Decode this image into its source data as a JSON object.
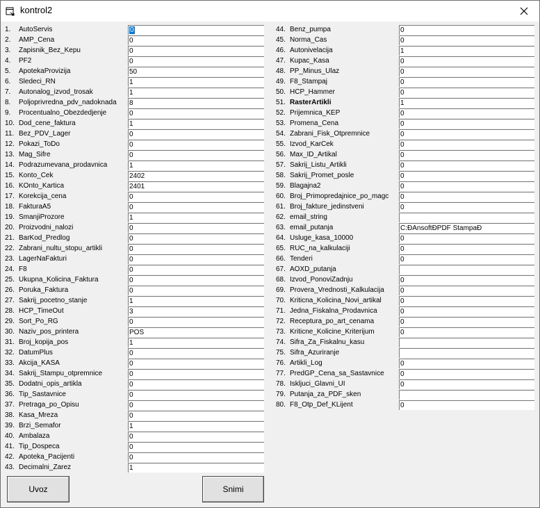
{
  "window": {
    "title": "kontrol2"
  },
  "left_rows": [
    {
      "num": "1.",
      "name": "AutoServis",
      "value": "0"
    },
    {
      "num": "2.",
      "name": "AMP_Cena",
      "value": "0"
    },
    {
      "num": "3.",
      "name": "Zapisnik_Bez_Kepu",
      "value": "0"
    },
    {
      "num": "4.",
      "name": "PF2",
      "value": "0"
    },
    {
      "num": "5.",
      "name": "ApotekaProvizija",
      "value": "50"
    },
    {
      "num": "6.",
      "name": "Sledeci_RN",
      "value": "1"
    },
    {
      "num": "7.",
      "name": "Autonalog_izvod_trosak",
      "value": "1"
    },
    {
      "num": "8.",
      "name": "Poljoprivredna_pdv_nadoknada",
      "value": "8"
    },
    {
      "num": "9.",
      "name": "Procentualno_Obezdedjenje",
      "value": "0"
    },
    {
      "num": "10.",
      "name": "Dod_cene_faktura",
      "value": "1"
    },
    {
      "num": "11.",
      "name": "Bez_PDV_Lager",
      "value": "0"
    },
    {
      "num": "12.",
      "name": "Pokazi_ToDo",
      "value": "0"
    },
    {
      "num": "13.",
      "name": "Mag_Sifre",
      "value": "0"
    },
    {
      "num": "14.",
      "name": "Podrazumevana_prodavnica",
      "value": "1"
    },
    {
      "num": "15.",
      "name": "Konto_Cek",
      "value": "2402"
    },
    {
      "num": "16.",
      "name": "KOnto_Kartica",
      "value": "2401"
    },
    {
      "num": "17.",
      "name": "Korekcija_cena",
      "value": "0"
    },
    {
      "num": "18.",
      "name": "FakturaA5",
      "value": "0"
    },
    {
      "num": "19.",
      "name": "SmanjiProzore",
      "value": "1"
    },
    {
      "num": "20.",
      "name": "Proizvodni_nalozi",
      "value": "0"
    },
    {
      "num": "21.",
      "name": "BarKod_Predlog",
      "value": "0"
    },
    {
      "num": "22.",
      "name": "Zabrani_nultu_stopu_artikli",
      "value": "0"
    },
    {
      "num": "23.",
      "name": "LagerNaFakturi",
      "value": "0"
    },
    {
      "num": "24.",
      "name": "F8",
      "value": "0"
    },
    {
      "num": "25.",
      "name": "Ukupna_Kolicina_Faktura",
      "value": "0"
    },
    {
      "num": "26.",
      "name": "Poruka_Faktura",
      "value": "0"
    },
    {
      "num": "27.",
      "name": "Sakrij_pocetno_stanje",
      "value": "1"
    },
    {
      "num": "28.",
      "name": "HCP_TimeOut",
      "value": "3"
    },
    {
      "num": "29.",
      "name": "Sort_Po_RG",
      "value": "0"
    },
    {
      "num": "30.",
      "name": "Naziv_pos_printera",
      "value": "POS"
    },
    {
      "num": "31.",
      "name": "Broj_kopija_pos",
      "value": "1"
    },
    {
      "num": "32.",
      "name": "DatumPlus",
      "value": "0"
    },
    {
      "num": "33.",
      "name": "Akcija_KASA",
      "value": "0"
    },
    {
      "num": "34.",
      "name": "Sakrij_Stampu_otpremnice",
      "value": "0"
    },
    {
      "num": "35.",
      "name": "Dodatni_opis_artikla",
      "value": "0"
    },
    {
      "num": "36.",
      "name": "Tip_Sastavnice",
      "value": "0"
    },
    {
      "num": "37.",
      "name": "Pretraga_po_Opisu",
      "value": "0"
    },
    {
      "num": "38.",
      "name": "Kasa_Mreza",
      "value": "0"
    },
    {
      "num": "39.",
      "name": "Brzi_Semafor",
      "value": "1"
    },
    {
      "num": "40.",
      "name": "Ambalaza",
      "value": "0"
    },
    {
      "num": "41.",
      "name": "Tip_Dospeca",
      "value": "0"
    },
    {
      "num": "42.",
      "name": "Apoteka_Pacijenti",
      "value": "0"
    },
    {
      "num": "43.",
      "name": "Decimalni_Zarez",
      "value": "1"
    }
  ],
  "right_rows": [
    {
      "num": "44.",
      "name": "Benz_pumpa",
      "value": "0"
    },
    {
      "num": "45.",
      "name": "Norma_Cas",
      "value": "0"
    },
    {
      "num": "46.",
      "name": "Autonivelacija",
      "value": "1"
    },
    {
      "num": "47.",
      "name": "Kupac_Kasa",
      "value": "0"
    },
    {
      "num": "48.",
      "name": "PP_Minus_Ulaz",
      "value": "0"
    },
    {
      "num": "49.",
      "name": "F8_Stampaj",
      "value": "0"
    },
    {
      "num": "50.",
      "name": "HCP_Hammer",
      "value": "0"
    },
    {
      "num": "51.",
      "name": "RasterArtikli",
      "value": "1"
    },
    {
      "num": "52.",
      "name": "Prijemnica_KEP",
      "value": "0"
    },
    {
      "num": "53.",
      "name": "Promena_Cena",
      "value": "0"
    },
    {
      "num": "54.",
      "name": "Zabrani_Fisk_Otpremnice",
      "value": "0"
    },
    {
      "num": "55.",
      "name": "Izvod_KarCek",
      "value": "0"
    },
    {
      "num": "56.",
      "name": "Max_ID_Artikal",
      "value": "0"
    },
    {
      "num": "57.",
      "name": "Sakrij_Listu_Artikli",
      "value": "0"
    },
    {
      "num": "58.",
      "name": "Sakrij_Promet_posle",
      "value": "0"
    },
    {
      "num": "59.",
      "name": "Blagajna2",
      "value": "0"
    },
    {
      "num": "60.",
      "name": "Broj_Primopredajnice_po_magc",
      "value": "0"
    },
    {
      "num": "61.",
      "name": "Broj_fakture_jedinstveni",
      "value": "0"
    },
    {
      "num": "62.",
      "name": "email_string",
      "value": ""
    },
    {
      "num": "63.",
      "name": "email_putanja",
      "value": "C:ĐAnsoftĐPDF StampaĐ"
    },
    {
      "num": "64.",
      "name": "Usluge_kasa_10000",
      "value": "0"
    },
    {
      "num": "65.",
      "name": "RUC_na_kalkulaciji",
      "value": "0"
    },
    {
      "num": "66.",
      "name": "Tenderi",
      "value": "0"
    },
    {
      "num": "67.",
      "name": "AOXD_putanja",
      "value": ""
    },
    {
      "num": "68.",
      "name": "Izvod_PonoviZadnju",
      "value": "0"
    },
    {
      "num": "69.",
      "name": "Provera_Vrednosti_Kalkulacija",
      "value": "0"
    },
    {
      "num": "70.",
      "name": "Kriticna_Kolicina_Novi_artikal",
      "value": "0"
    },
    {
      "num": "71.",
      "name": "Jedna_Fiskalna_Prodavnica",
      "value": "0"
    },
    {
      "num": "72.",
      "name": "Receptura_po_art_cenama",
      "value": "0"
    },
    {
      "num": "73.",
      "name": "Kriticne_Kolicine_Kriterijum",
      "value": "0"
    },
    {
      "num": "74.",
      "name": "Sifra_Za_Fiskalnu_kasu",
      "value": ""
    },
    {
      "num": "75.",
      "name": "Sifra_Azuriranje",
      "value": ""
    },
    {
      "num": "76.",
      "name": "Artikli_Log",
      "value": "0"
    },
    {
      "num": "77.",
      "name": "PredGP_Cena_sa_Sastavnice",
      "value": "0"
    },
    {
      "num": "78.",
      "name": "Iskljuci_Glavni_UI",
      "value": "0"
    },
    {
      "num": "79.",
      "name": "Putanja_za_PDF_sken",
      "value": ""
    },
    {
      "num": "80.",
      "name": "F8_Otp_Def_KLijent",
      "value": "0"
    }
  ],
  "buttons": {
    "uvoz": "Uvoz",
    "snimi": "Snimi"
  }
}
